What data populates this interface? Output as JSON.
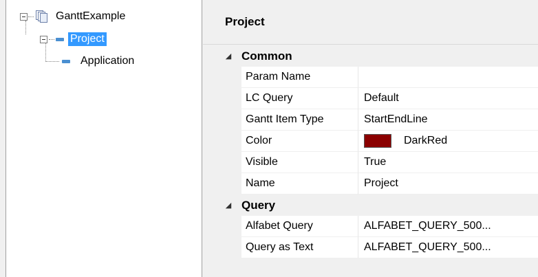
{
  "tree": {
    "root": {
      "label": "GanttExample"
    },
    "child": {
      "label": "Project"
    },
    "grandchild": {
      "label": "Application"
    }
  },
  "panel": {
    "title": "Project"
  },
  "categories": [
    {
      "label": "Common",
      "properties": [
        {
          "name": "Param Name",
          "value": ""
        },
        {
          "name": "LC Query",
          "value": "Default"
        },
        {
          "name": "Gantt Item Type",
          "value": "StartEndLine"
        },
        {
          "name": "Color",
          "value": "DarkRed",
          "swatch": "#8b0000"
        },
        {
          "name": "Visible",
          "value": "True"
        },
        {
          "name": "Name",
          "value": "Project"
        }
      ]
    },
    {
      "label": "Query",
      "properties": [
        {
          "name": "Alfabet Query",
          "value": "ALFABET_QUERY_500..."
        },
        {
          "name": "Query as Text",
          "value": "ALFABET_QUERY_500..."
        }
      ]
    }
  ],
  "colors": {
    "selection": "#3399ff",
    "node_icon": "#4a8fd1"
  }
}
